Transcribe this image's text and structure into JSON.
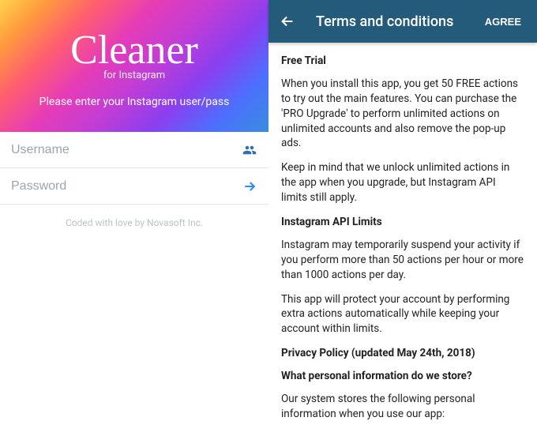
{
  "left": {
    "app_title": "Cleaner",
    "app_subtitle": "for Instagram",
    "prompt": "Please enter your Instagram user/pass",
    "username_placeholder": "Username",
    "password_placeholder": "Password",
    "footer": "Coded with love by Novasoft Inc."
  },
  "right": {
    "toolbar": {
      "title": "Terms and conditions",
      "agree": "AGREE"
    },
    "sections": {
      "free_trial_heading": "Free Trial",
      "free_trial_p1": "When you install this app, you get 50 FREE actions to try out the main features. You can purchase the 'PRO Upgrade' to perform unlimited actions on unlimited accounts and also remove the pop-up ads.",
      "free_trial_p2": "Keep in mind that we unlock unlimited actions in the app when you upgrade, but Instagram API limits still apply.",
      "api_heading": "Instagram API Limits",
      "api_p1": "Instagram may temporarily suspend your activity if you perform more than 50 actions per hour or more than 1000 actions per day.",
      "api_p2": "This app will protect your account by performing extra actions automatically while keeping your account within limits.",
      "privacy_heading": "Privacy Policy (updated May 24th, 2018)",
      "privacy_q": "What personal information do we store?",
      "privacy_p1": "Our system stores the following personal information when you use our app:"
    }
  }
}
